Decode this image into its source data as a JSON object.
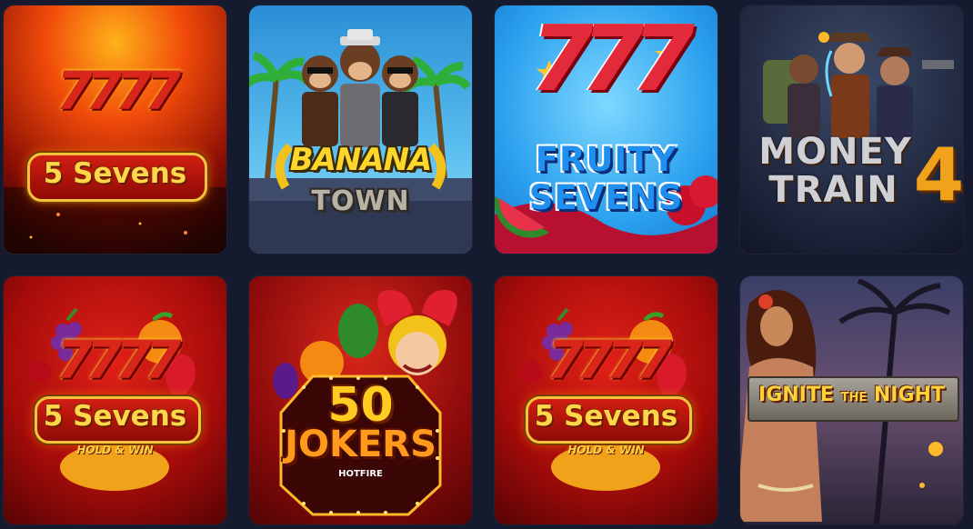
{
  "games": [
    {
      "id": "five-sevens",
      "title": "5 Sevens",
      "sevens": "7777"
    },
    {
      "id": "banana-town",
      "title_line1": "BANANA",
      "title_line2": "TOWN"
    },
    {
      "id": "fruity-sevens",
      "sevens": "777",
      "title_line1": "FRUITY",
      "title_line2": "SEVENS"
    },
    {
      "id": "money-train-4",
      "title_line1": "MONEY",
      "title_line2": "TRAIN",
      "number": "4"
    },
    {
      "id": "five-sevens-hold-win",
      "title": "5 Sevens",
      "sevens": "7777",
      "subtitle": "HOLD & WIN"
    },
    {
      "id": "fifty-jokers",
      "number": "50",
      "title": "JOKERS",
      "subtitle": "HOTFIRE"
    },
    {
      "id": "five-sevens-hold-win-2",
      "title": "5 Sevens",
      "sevens": "7777",
      "subtitle": "HOLD & WIN"
    },
    {
      "id": "ignite-the-night",
      "title_part1": "IGNITE",
      "title_part2": "THE",
      "title_part3": "NIGHT"
    }
  ],
  "colors": {
    "background": "#151a2e",
    "accent_gold": "#f5c33b",
    "accent_red": "#d21d12"
  }
}
